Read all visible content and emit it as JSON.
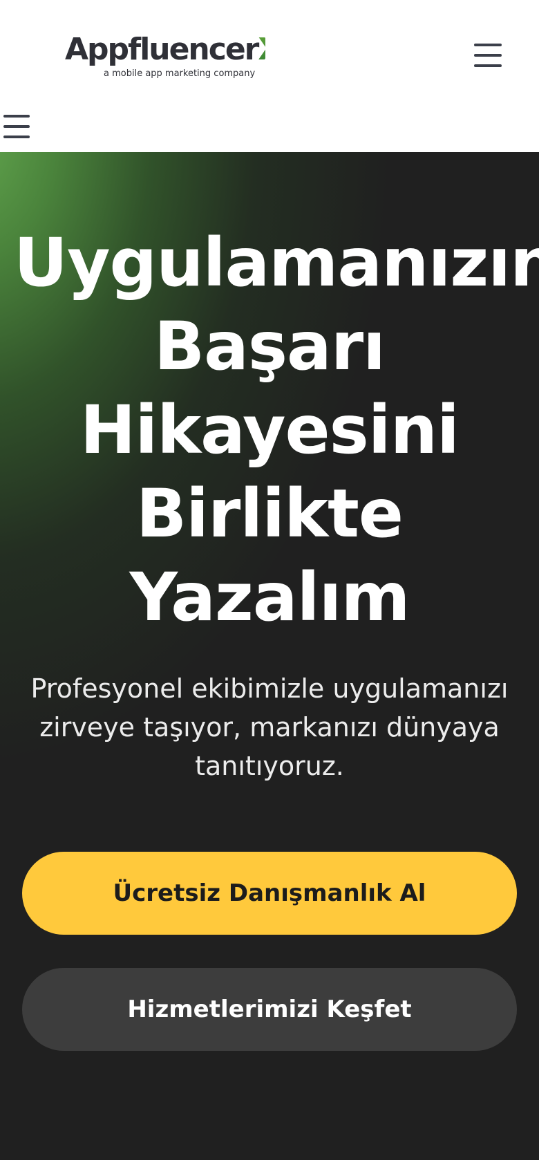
{
  "header": {
    "logo": {
      "brand_prefix": "Appfluencer",
      "brand_suffix": "X",
      "tagline": "a mobile app marketing company",
      "brand_color": "#2f3037",
      "accent_color": "#8cc63f",
      "accent_dark": "#2e7d32"
    },
    "menu_icon": "hamburger-menu-icon",
    "secondary_menu_icon": "hamburger-menu-icon"
  },
  "hero": {
    "title": "Uygulamanızın Başarı Hikayesini Birlikte Yazalım",
    "subtitle": "Profesyonel ekibimizle uygulamanızı zirveye taşıyor, markanızı dünyaya tanıtıyoruz.",
    "primary_button": "Ücretsiz Danışmanlık Al",
    "secondary_button": "Hizmetlerimizi Keşfet",
    "colors": {
      "background": "#202020",
      "gradient_green": "#62a64e",
      "primary_button_bg": "#ffc93c",
      "secondary_button_bg": "#3d3d3d"
    }
  }
}
